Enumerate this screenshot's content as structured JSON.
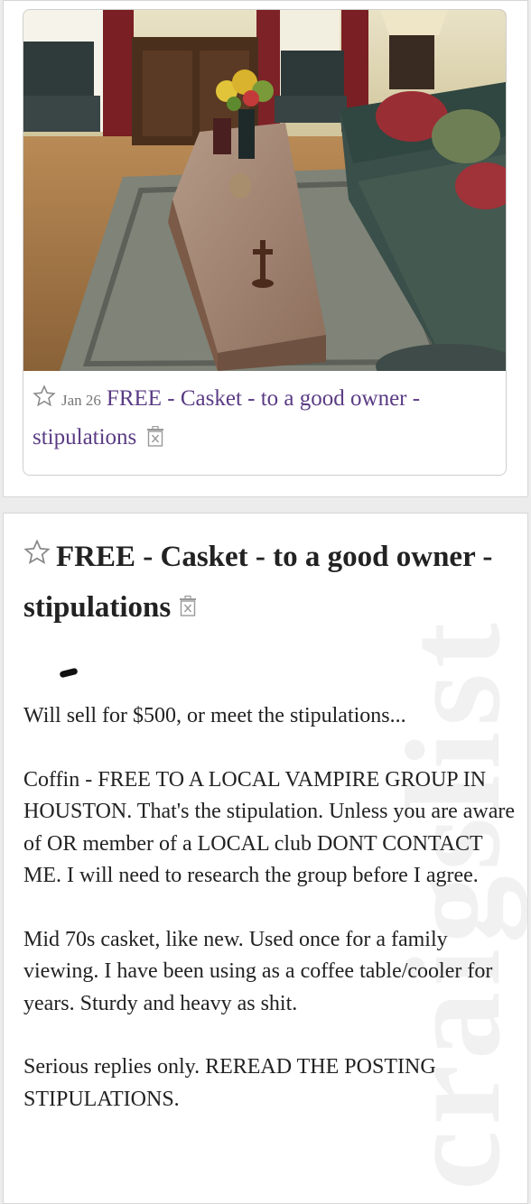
{
  "listing_card": {
    "date": "Jan 26",
    "title": "FREE - Casket - to a good owner - stipulations",
    "favorite_icon": "star-outline-icon",
    "hide_icon": "hide-trash-icon"
  },
  "posting": {
    "title": "FREE - Casket - to a good owner - stipulations",
    "favorite_icon": "star-outline-icon",
    "hide_icon": "hide-trash-icon",
    "paragraphs": [
      "Will sell for $500, or meet the stipulations...",
      "Coffin - FREE TO A LOCAL VAMPIRE GROUP IN HOUSTON. That's the stipulation. Unless you are aware of OR member of a LOCAL club DONT CONTACT ME. I will need to research the group before I agree.",
      "Mid 70s casket, like new. Used once for a family viewing. I have been using as a coffee table/cooler for years. Sturdy and heavy as shit.",
      "Serious replies only. REREAD THE POSTING STIPULATIONS."
    ],
    "watermark": "craigslist"
  },
  "colors": {
    "link_purple": "#5a3b84",
    "text": "#222222"
  }
}
